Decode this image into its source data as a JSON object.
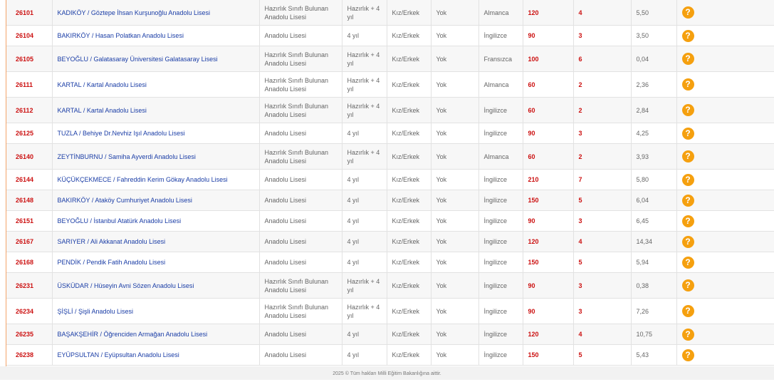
{
  "rows": [
    {
      "code": "26101",
      "name": "KADIKÖY / Göztepe İhsan Kurşunoğlu Anadolu Lisesi",
      "type": "Hazırlık Sınıfı Bulunan Anadolu Lisesi",
      "duration": "Hazırlık + 4 yıl",
      "gender": "Kız/Erkek",
      "pansiyon": "Yok",
      "language": "Almanca",
      "quota": "120",
      "extra": "4",
      "score": "5,50",
      "icon": "question-icon"
    },
    {
      "code": "26104",
      "name": "BAKIRKÖY / Hasan Polatkan Anadolu Lisesi",
      "type": "Anadolu Lisesi",
      "duration": "4 yıl",
      "gender": "Kız/Erkek",
      "pansiyon": "Yok",
      "language": "İngilizce",
      "quota": "90",
      "extra": "3",
      "score": "3,50",
      "icon": "question-icon"
    },
    {
      "code": "26105",
      "name": "BEYOĞLU / Galatasaray Üniversitesi Galatasaray Lisesi",
      "type": "Hazırlık Sınıfı Bulunan Anadolu Lisesi",
      "duration": "Hazırlık + 4 yıl",
      "gender": "Kız/Erkek",
      "pansiyon": "Yok",
      "language": "Fransızca",
      "quota": "100",
      "extra": "6",
      "score": "0,04",
      "icon": "question-icon"
    },
    {
      "code": "26111",
      "name": "KARTAL / Kartal Anadolu Lisesi",
      "type": "Hazırlık Sınıfı Bulunan Anadolu Lisesi",
      "duration": "Hazırlık + 4 yıl",
      "gender": "Kız/Erkek",
      "pansiyon": "Yok",
      "language": "Almanca",
      "quota": "60",
      "extra": "2",
      "score": "2,36",
      "icon": "question-icon"
    },
    {
      "code": "26112",
      "name": "KARTAL / Kartal Anadolu Lisesi",
      "type": "Hazırlık Sınıfı Bulunan Anadolu Lisesi",
      "duration": "Hazırlık + 4 yıl",
      "gender": "Kız/Erkek",
      "pansiyon": "Yok",
      "language": "İngilizce",
      "quota": "60",
      "extra": "2",
      "score": "2,84",
      "icon": "question-icon"
    },
    {
      "code": "26125",
      "name": "TUZLA / Behiye Dr.Nevhiz Işıl Anadolu Lisesi",
      "type": "Anadolu Lisesi",
      "duration": "4 yıl",
      "gender": "Kız/Erkek",
      "pansiyon": "Yok",
      "language": "İngilizce",
      "quota": "90",
      "extra": "3",
      "score": "4,25",
      "icon": "question-icon"
    },
    {
      "code": "26140",
      "name": "ZEYTİNBURNU / Samiha Ayverdi Anadolu Lisesi",
      "type": "Hazırlık Sınıfı Bulunan Anadolu Lisesi",
      "duration": "Hazırlık + 4 yıl",
      "gender": "Kız/Erkek",
      "pansiyon": "Yok",
      "language": "Almanca",
      "quota": "60",
      "extra": "2",
      "score": "3,93",
      "icon": "question-icon"
    },
    {
      "code": "26144",
      "name": "KÜÇÜKÇEKMECE / Fahreddin Kerim Gökay Anadolu Lisesi",
      "type": "Anadolu Lisesi",
      "duration": "4 yıl",
      "gender": "Kız/Erkek",
      "pansiyon": "Yok",
      "language": "İngilizce",
      "quota": "210",
      "extra": "7",
      "score": "5,80",
      "icon": "question-icon"
    },
    {
      "code": "26148",
      "name": "BAKIRKÖY / Ataköy Cumhuriyet Anadolu Lisesi",
      "type": "Anadolu Lisesi",
      "duration": "4 yıl",
      "gender": "Kız/Erkek",
      "pansiyon": "Yok",
      "language": "İngilizce",
      "quota": "150",
      "extra": "5",
      "score": "6,04",
      "icon": "question-icon"
    },
    {
      "code": "26151",
      "name": "BEYOĞLU / İstanbul Atatürk Anadolu Lisesi",
      "type": "Anadolu Lisesi",
      "duration": "4 yıl",
      "gender": "Kız/Erkek",
      "pansiyon": "Yok",
      "language": "İngilizce",
      "quota": "90",
      "extra": "3",
      "score": "6,45",
      "icon": "question-icon"
    },
    {
      "code": "26167",
      "name": "SARIYER / Ali Akkanat Anadolu Lisesi",
      "type": "Anadolu Lisesi",
      "duration": "4 yıl",
      "gender": "Kız/Erkek",
      "pansiyon": "Yok",
      "language": "İngilizce",
      "quota": "120",
      "extra": "4",
      "score": "14,34",
      "icon": "question-icon"
    },
    {
      "code": "26168",
      "name": "PENDİK / Pendik Fatih Anadolu Lisesi",
      "type": "Anadolu Lisesi",
      "duration": "4 yıl",
      "gender": "Kız/Erkek",
      "pansiyon": "Yok",
      "language": "İngilizce",
      "quota": "150",
      "extra": "5",
      "score": "5,94",
      "icon": "question-icon"
    },
    {
      "code": "26231",
      "name": "ÜSKÜDAR / Hüseyin Avni Sözen Anadolu Lisesi",
      "type": "Hazırlık Sınıfı Bulunan Anadolu Lisesi",
      "duration": "Hazırlık + 4 yıl",
      "gender": "Kız/Erkek",
      "pansiyon": "Yok",
      "language": "İngilizce",
      "quota": "90",
      "extra": "3",
      "score": "0,38",
      "icon": "question-icon"
    },
    {
      "code": "26234",
      "name": "ŞİŞLİ / Şişli Anadolu Lisesi",
      "type": "Hazırlık Sınıfı Bulunan Anadolu Lisesi",
      "duration": "Hazırlık + 4 yıl",
      "gender": "Kız/Erkek",
      "pansiyon": "Yok",
      "language": "İngilizce",
      "quota": "90",
      "extra": "3",
      "score": "7,26",
      "icon": "question-icon"
    },
    {
      "code": "26235",
      "name": "BAŞAKŞEHİR / Öğrenciden Armağan Anadolu Lisesi",
      "type": "Anadolu Lisesi",
      "duration": "4 yıl",
      "gender": "Kız/Erkek",
      "pansiyon": "Yok",
      "language": "İngilizce",
      "quota": "120",
      "extra": "4",
      "score": "10,75",
      "icon": "question-icon"
    },
    {
      "code": "26238",
      "name": "EYÜPSULTAN / Eyüpsultan Anadolu Lisesi",
      "type": "Anadolu Lisesi",
      "duration": "4 yıl",
      "gender": "Kız/Erkek",
      "pansiyon": "Yok",
      "language": "İngilizce",
      "quota": "150",
      "extra": "5",
      "score": "5,43",
      "icon": "question-icon"
    }
  ],
  "help_glyph": "?",
  "footer": {
    "text": "2025 © Tüm hakları Milli Eğitim Bakanlığına aittir."
  },
  "colors": {
    "code": "#cc1111",
    "link": "#1a3da6",
    "help_icon": "#f5a00f",
    "accent_line": "#f3a46a"
  }
}
